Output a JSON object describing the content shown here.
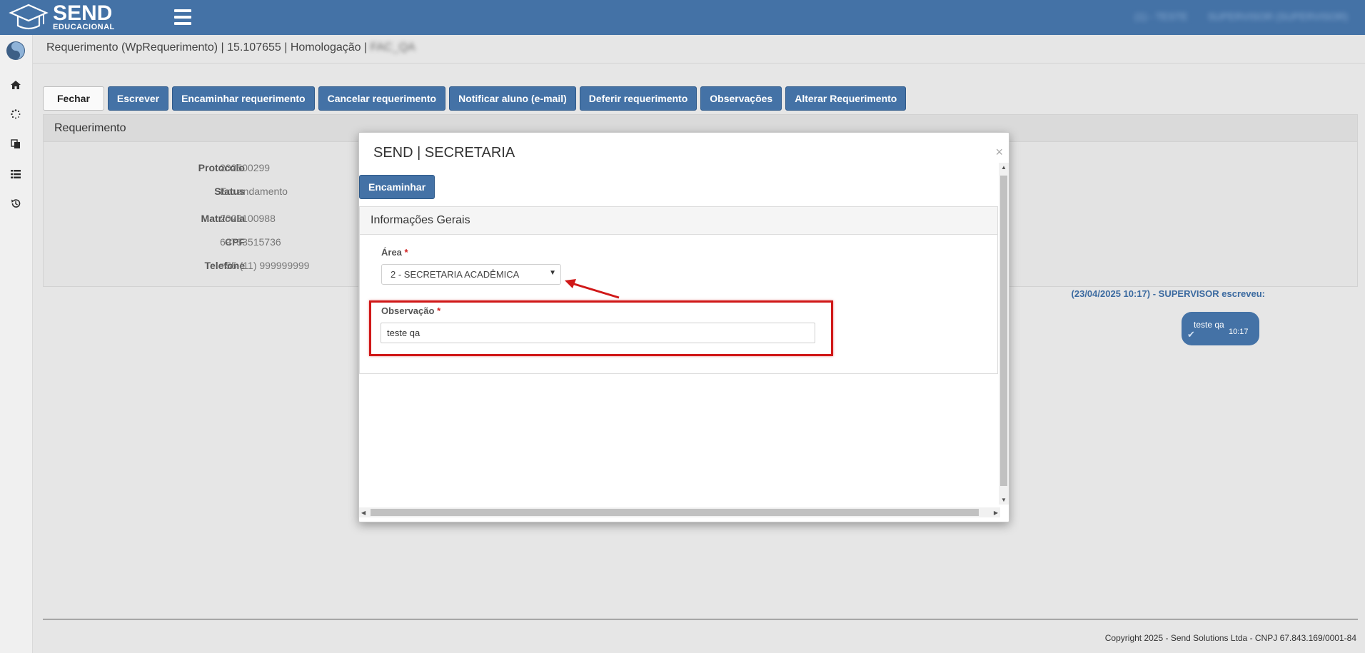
{
  "header": {
    "logo_main": "SEND",
    "logo_sub": "EDUCACIONAL",
    "menu_icon": "hamburger-icon",
    "user_menu_1": "(1) - TESTE",
    "user_menu_2": "SUPERVISOR (SUPERVISOR)"
  },
  "sidebar": {
    "icons": [
      "home-icon",
      "spinner-icon",
      "copy-icon",
      "list-icon",
      "history-icon"
    ]
  },
  "breadcrumb": {
    "text": "Requerimento (WpRequerimento) | 15.107655 | Homologação |",
    "env": "FAC_QA"
  },
  "toolbar": {
    "buttons": [
      "Fechar",
      "Escrever",
      "Encaminhar requerimento",
      "Cancelar requerimento",
      "Notificar aluno (e-mail)",
      "Deferir requerimento",
      "Observações",
      "Alterar Requerimento"
    ]
  },
  "requerimento": {
    "title": "Requerimento",
    "fields": [
      {
        "label": "Protocolo",
        "value": "202500299"
      },
      {
        "label": "Status",
        "value": "Em andamento"
      },
      {
        "label": "Matrícula",
        "value": "2023100988"
      },
      {
        "label": "CPF",
        "value": "69733515736"
      },
      {
        "label": "Telefone",
        "value": "+55 (11) 999999999"
      }
    ]
  },
  "chat": {
    "header": "(23/04/2025 10:17) - SUPERVISOR escreveu:",
    "message": "teste qa",
    "time": "10:17"
  },
  "modal": {
    "title": "SEND | SECRETARIA",
    "close": "×",
    "action_button": "Encaminhar",
    "section_title": "Informações Gerais",
    "area_label": "Área",
    "area_value": "2 - SECRETARIA ACADÊMICA",
    "obs_label": "Observação",
    "obs_value": "teste qa",
    "required_mark": "*",
    "annotation_color": "#d01818"
  },
  "footer": {
    "text": "Copyright 2025 - Send Solutions Ltda - CNPJ 67.843.169/0001-84"
  },
  "colors": {
    "primary": "#4472a6",
    "background": "#e6e6e6"
  }
}
